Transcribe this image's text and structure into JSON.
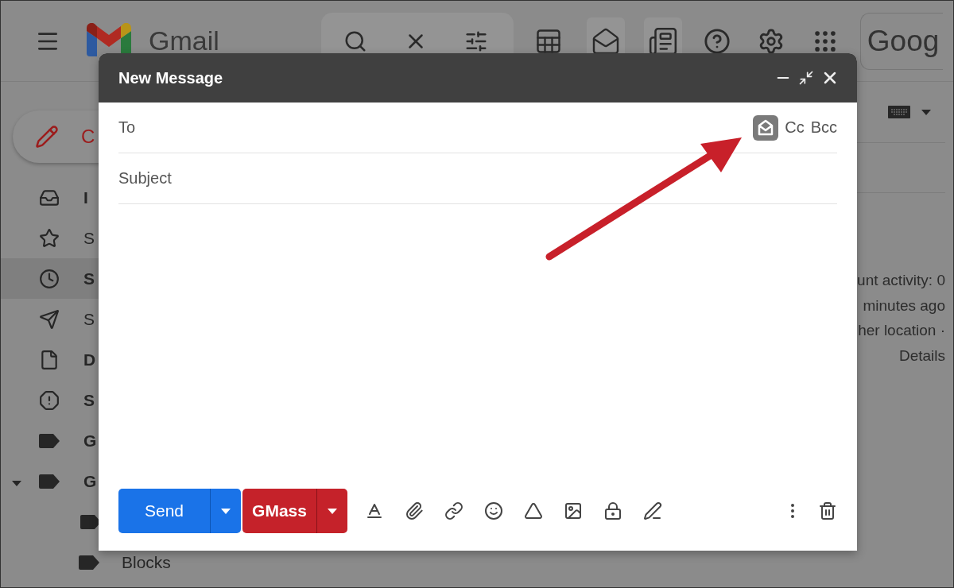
{
  "app": {
    "name": "Gmail",
    "account_button": "Goog"
  },
  "compose_button": {
    "label": "C"
  },
  "sidebar": {
    "items": [
      {
        "kind": "inbox",
        "label": "I",
        "unread": true,
        "selected": false
      },
      {
        "kind": "starred",
        "label": "S",
        "unread": false,
        "selected": false
      },
      {
        "kind": "snoozed",
        "label": "S",
        "unread": true,
        "selected": true
      },
      {
        "kind": "sent",
        "label": "S",
        "unread": false,
        "selected": false
      },
      {
        "kind": "drafts",
        "label": "D",
        "unread": true,
        "selected": false
      },
      {
        "kind": "spam",
        "label": "S",
        "unread": true,
        "selected": false
      },
      {
        "kind": "label",
        "label": "G",
        "unread": true,
        "selected": false
      },
      {
        "kind": "label",
        "label": "G",
        "unread": true,
        "selected": false,
        "expanded": true,
        "children": [
          {
            "kind": "label",
            "selected": false
          },
          {
            "kind": "label",
            "label": "Blocks",
            "unread": false,
            "selected": false
          }
        ]
      }
    ]
  },
  "activity_lines": [
    "unt activity: 0",
    "minutes ago",
    "her location ·",
    "Details"
  ],
  "compose": {
    "title": "New Message",
    "to_label": "To",
    "subject_placeholder": "Subject",
    "cc": "Cc",
    "bcc": "Bcc",
    "send": "Send",
    "gmass": "GMass"
  }
}
